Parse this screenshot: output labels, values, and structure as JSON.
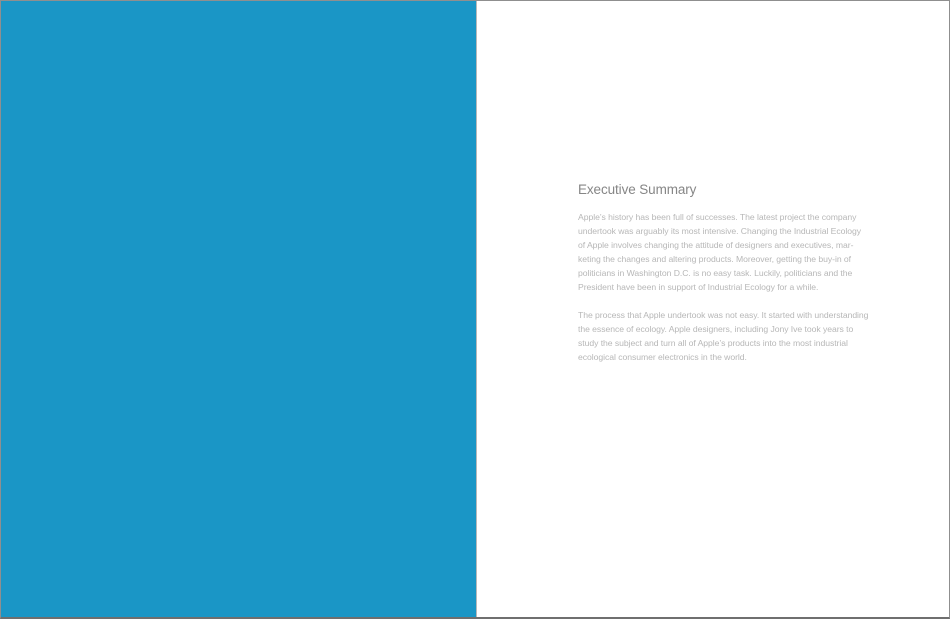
{
  "colors": {
    "left_page_fill": "#1a96c6",
    "title_text": "#868686",
    "body_text": "#b7b7b7"
  },
  "document": {
    "right_page": {
      "title": "Executive Summary",
      "paragraph_1": "Apple’s history has been full of successes. The latest project the company undertook was arguably its most intensive. Changing the Industrial Ecology of Apple involves changing the attitude of designers and executives, mar­keting the changes and altering products. Moreover, getting the buy-in of politicians in Washington D.C. is no easy task. Luckily, politicians and the President have been in support of Industrial Ecology for a while.",
      "paragraph_2": "The process that Apple undertook was not easy. It started with under­standing the essence of ecology. Apple designers, including Jony Ive took years to study the subject and turn all of Apple’s products into the most industrial ecological consumer electronics in the world."
    }
  }
}
